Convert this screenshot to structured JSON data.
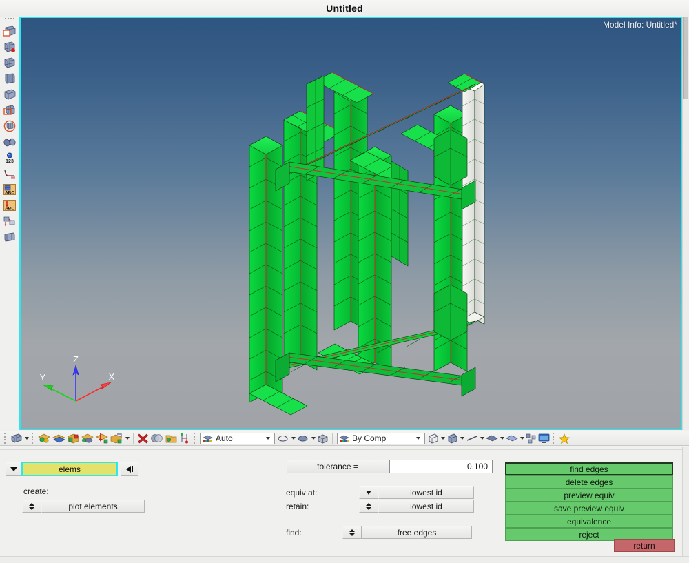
{
  "window": {
    "title": "Untitled"
  },
  "viewport": {
    "model_info": "Model Info: Untitled*",
    "bg_top_color": "#2e5580",
    "bg_bottom_color": "#a0a4a8",
    "border_color": "#2ee6f2",
    "mesh_color": "#00d43c",
    "mesh_highlight_color": "#f0f0f0",
    "feature_edge_color": "#cc2b2b",
    "triad": {
      "x_label": "X",
      "y_label": "Y",
      "z_label": "Z",
      "x_color": "#ff2a2a",
      "y_color": "#19d419",
      "z_color": "#3636ff"
    }
  },
  "left_toolbar": {
    "items": [
      {
        "name": "geometry-panel-icon",
        "label": "Geometry"
      },
      {
        "name": "2d-mesh-panel-icon",
        "label": "2D"
      },
      {
        "name": "3d-mesh-panel-icon",
        "label": "3D"
      },
      {
        "name": "mesh-edit-panel-icon",
        "label": "Mesh Edit"
      },
      {
        "name": "analysis-panel-icon",
        "label": "Analysis"
      },
      {
        "name": "mesh-quality-panel-icon",
        "label": "Quality"
      },
      {
        "name": "tool-panel-icon",
        "label": "Tool"
      },
      {
        "name": "node-numbering-icon",
        "label": "Numbers"
      },
      {
        "name": "measure-angle-icon",
        "label": "Measure"
      },
      {
        "name": "abc-card-icon",
        "label": "Card Edit"
      },
      {
        "name": "abc-load-icon",
        "label": "Load Card"
      },
      {
        "name": "morph-panel-icon",
        "label": "Morph"
      },
      {
        "name": "post-panel-icon",
        "label": "Post"
      }
    ]
  },
  "bottom_toolbar": {
    "groups": [
      {
        "name": "visualization-group",
        "items": [
          {
            "name": "mesh-display-icon",
            "label": "Mesh Display",
            "has_dropdown": true
          }
        ]
      },
      {
        "name": "display-group",
        "items": [
          {
            "name": "components-display-icon",
            "label": "Components",
            "has_dropdown": false
          },
          {
            "name": "geometry-display-icon",
            "label": "Geometry",
            "has_dropdown": false
          },
          {
            "name": "shrink-elements-icon",
            "label": "Shrink Elements",
            "has_dropdown": false
          },
          {
            "name": "element-normals-icon",
            "label": "Element Normals",
            "has_dropdown": false
          },
          {
            "name": "load-display-icon",
            "label": "Loads",
            "has_dropdown": false
          },
          {
            "name": "mask-display-icon",
            "label": "Mask",
            "has_dropdown": true
          }
        ]
      },
      {
        "name": "mask-group",
        "items": [
          {
            "name": "mask-delete-icon",
            "label": "Mask"
          },
          {
            "name": "spheres-icon",
            "label": "Spheres"
          },
          {
            "name": "unmask-icon",
            "label": "Unmask"
          },
          {
            "name": "find-attached-icon",
            "label": "Find Attached"
          }
        ]
      },
      {
        "name": "view-group",
        "items": [
          {
            "name": "auto-color-icon",
            "label": "Auto",
            "has_dropdown": false
          }
        ]
      }
    ],
    "auto_combo": {
      "name": "color-mode-combo",
      "value": "Auto"
    },
    "bycomp_combo": {
      "name": "display-mode-combo",
      "value": "By Comp"
    },
    "right_items": [
      {
        "name": "wireframe-icon",
        "label": "Wireframe",
        "has_dropdown": true
      },
      {
        "name": "shaded-icon",
        "label": "Shaded",
        "has_dropdown": true
      },
      {
        "name": "line-display-icon",
        "label": "Lines",
        "has_dropdown": true
      },
      {
        "name": "surface-display-icon",
        "label": "Surfaces",
        "has_dropdown": true
      },
      {
        "name": "solid-display-icon",
        "label": "Solids",
        "has_dropdown": true
      },
      {
        "name": "assembly-icon",
        "label": "Assembly",
        "has_dropdown": false
      },
      {
        "name": "monitor-icon",
        "label": "Graphics",
        "has_dropdown": false
      },
      {
        "name": "favorite-star-icon",
        "label": "Favorites",
        "has_dropdown": false
      }
    ]
  },
  "panel": {
    "entity_selector": {
      "dropdown_name": "entity-type-dropdown",
      "value": "elems",
      "rewind_name": "reset-selection-button"
    },
    "create": {
      "label": "create:",
      "option_value": "plot elements"
    },
    "tolerance": {
      "label": "tolerance =",
      "value": "0.100"
    },
    "equiv_at": {
      "label": "equiv at:",
      "value": "lowest id"
    },
    "retain": {
      "label": "retain:",
      "value": "lowest id"
    },
    "find": {
      "label": "find:",
      "value": "free edges"
    },
    "action_buttons": [
      {
        "label": "find edges",
        "name": "find-edges-button",
        "focused": true
      },
      {
        "label": "delete edges",
        "name": "delete-edges-button",
        "focused": false
      },
      {
        "label": "preview equiv",
        "name": "preview-equiv-button",
        "focused": false
      },
      {
        "label": "save preview equiv",
        "name": "save-preview-equiv-button",
        "focused": false
      },
      {
        "label": "equivalence",
        "name": "equivalence-button",
        "focused": false
      },
      {
        "label": "reject",
        "name": "reject-button",
        "focused": false
      }
    ],
    "return_button": {
      "label": "return",
      "name": "return-button"
    },
    "colors": {
      "green_button": "#66c96b",
      "return_button": "#c4666a",
      "entity_field": "#e3e36b",
      "entity_border": "#2ee6f2"
    }
  }
}
